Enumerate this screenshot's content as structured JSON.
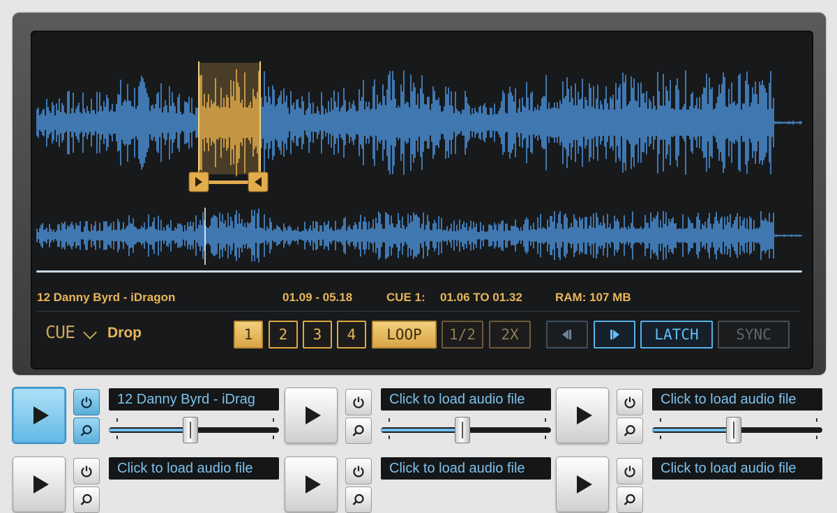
{
  "deck": {
    "track_title": "12 Danny Byrd - iDragon",
    "time_range": "01.09 - 05.18",
    "cue_label": "CUE 1:",
    "cue_range": "01.06 TO 01.32",
    "ram": "RAM: 107 MB",
    "mode_label": "CUE",
    "mode_value": "Drop",
    "cue_buttons": [
      "1",
      "2",
      "3",
      "4"
    ],
    "loop_label": "LOOP",
    "half_label": "1/2",
    "double_label": "2X",
    "latch_label": "LATCH",
    "sync_label": "SYNC",
    "colors": {
      "waveform": "#4b8fd6",
      "loop_region": "#e3ad4c",
      "accent_blue": "#58b2ea"
    }
  },
  "mini_decks": [
    {
      "file_label": "12 Danny Byrd - iDrag",
      "active": true,
      "volume": 0.48
    },
    {
      "file_label": "Click to load audio file",
      "active": false,
      "volume": 0.48
    },
    {
      "file_label": "Click to load audio file",
      "active": false,
      "volume": 0.48
    },
    {
      "file_label": "Click to load audio file",
      "active": false
    },
    {
      "file_label": "Click to load audio file",
      "active": false
    },
    {
      "file_label": "Click to load audio file",
      "active": false
    }
  ],
  "icons": {
    "play": "play-icon",
    "power": "power-icon",
    "zoom": "magnifier-icon",
    "prev": "skip-back-icon",
    "next": "skip-forward-icon"
  }
}
